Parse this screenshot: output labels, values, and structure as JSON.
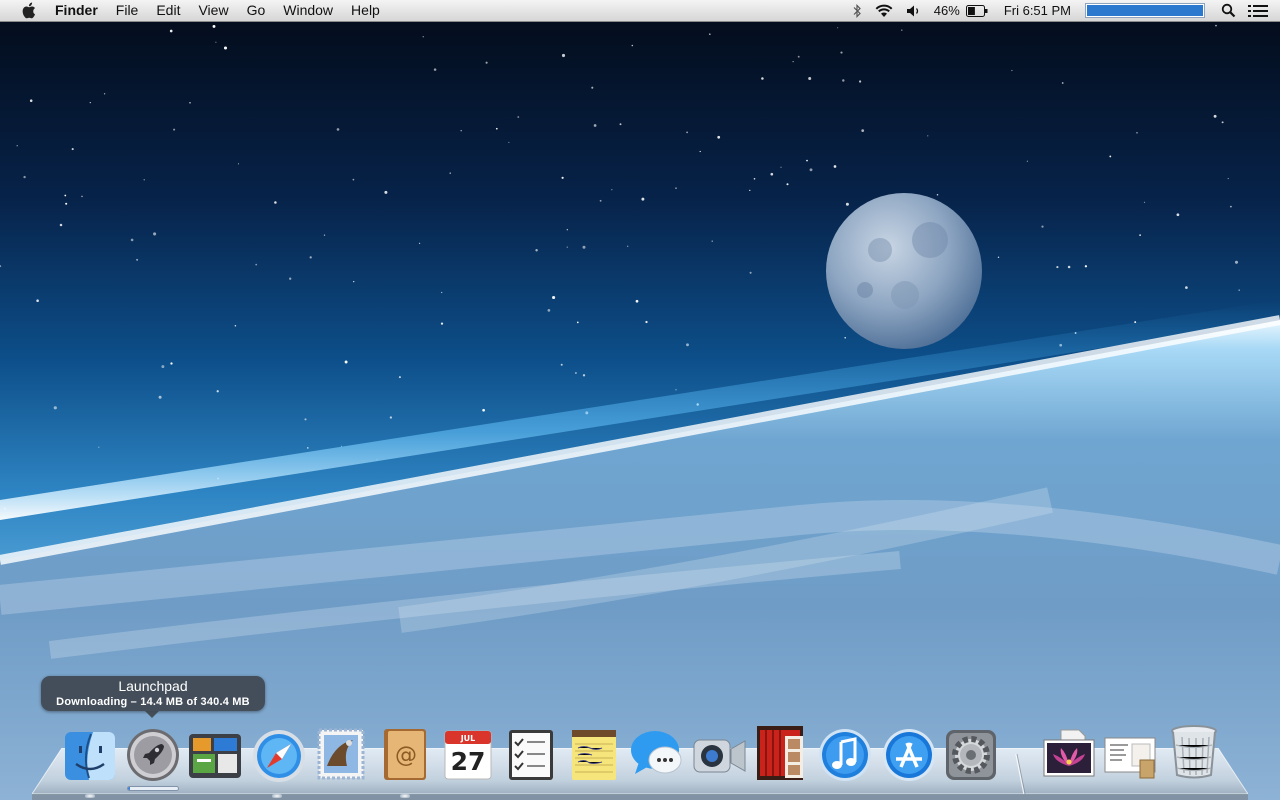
{
  "menubar": {
    "apple_icon": "apple-icon",
    "app_name": "Finder",
    "menus": [
      "File",
      "Edit",
      "View",
      "Go",
      "Window",
      "Help"
    ],
    "status": {
      "bluetooth_icon": "bluetooth-icon",
      "wifi_icon": "wifi-icon",
      "volume_icon": "volume-icon",
      "battery_percent": "46%",
      "battery_level": 0.46,
      "battery_icon": "battery-icon",
      "clock": "Fri 6:51 PM",
      "spotlight_icon": "search-icon",
      "notifications_icon": "list-icon"
    }
  },
  "tooltip": {
    "title": "Launchpad",
    "subtitle": "Downloading – 14.4 MB of 340.4 MB"
  },
  "download": {
    "downloaded_mb": 14.4,
    "total_mb": 340.4,
    "progress": 0.042
  },
  "dock": {
    "apps": [
      {
        "name": "Finder",
        "icon": "finder-icon",
        "running": true
      },
      {
        "name": "Launchpad",
        "icon": "rocket-icon",
        "running": false
      },
      {
        "name": "Mission Control",
        "icon": "mission-control-icon",
        "running": false
      },
      {
        "name": "Safari",
        "icon": "compass-icon",
        "running": false
      },
      {
        "name": "Mail",
        "icon": "mail-stamp-icon",
        "running": false
      },
      {
        "name": "Contacts",
        "icon": "address-book-icon",
        "running": false
      },
      {
        "name": "Calendar",
        "icon": "calendar-icon",
        "month": "JUL",
        "day": "27",
        "running": false
      },
      {
        "name": "Reminders",
        "icon": "checklist-icon",
        "running": false
      },
      {
        "name": "Notes",
        "icon": "notepad-icon",
        "running": false
      },
      {
        "name": "Messages",
        "icon": "speech-bubble-icon",
        "running": false
      },
      {
        "name": "FaceTime",
        "icon": "video-camera-icon",
        "running": false
      },
      {
        "name": "Photo Booth",
        "icon": "photo-booth-icon",
        "running": false
      },
      {
        "name": "iTunes",
        "icon": "music-note-icon",
        "running": false
      },
      {
        "name": "App Store",
        "icon": "app-store-icon",
        "running": false
      },
      {
        "name": "System Preferences",
        "icon": "gear-icon",
        "running": false
      }
    ],
    "stacks": [
      {
        "name": "Photo",
        "icon": "photo-icon"
      },
      {
        "name": "Documents",
        "icon": "document-stack-icon"
      }
    ],
    "trash": {
      "name": "Trash",
      "icon": "trash-icon"
    }
  },
  "colors": {
    "sky_top": "#040d1c",
    "sky_horizon": "#5fb6e6",
    "menubar": "#e8e8e8",
    "progress": "#3f7fd8",
    "spotlight_field": "#2b78cf"
  }
}
